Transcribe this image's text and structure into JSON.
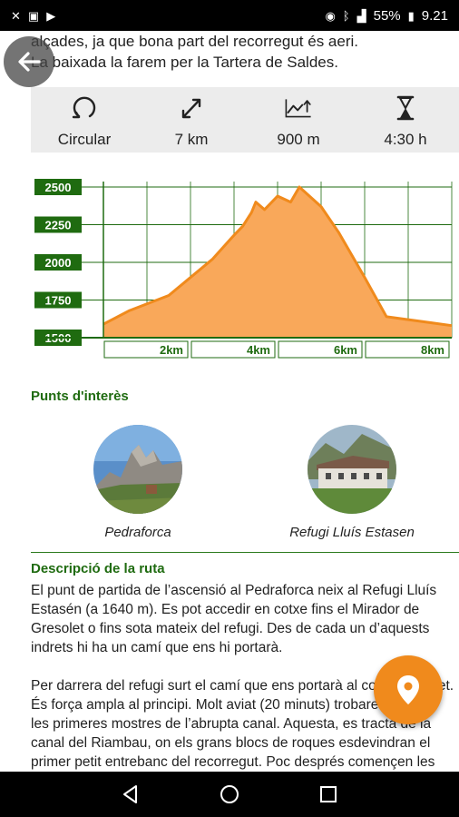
{
  "status_bar": {
    "battery": "55%",
    "time": "9.21"
  },
  "intro_lines": [
    "alçades, ja que bona part del recorregut és aeri.",
    "La baixada la farem per la Tartera de Saldes."
  ],
  "stats": [
    {
      "icon": "loop-icon",
      "label": "Circular"
    },
    {
      "icon": "distance-icon",
      "label": "7 km"
    },
    {
      "icon": "elevation-icon",
      "label": "900 m"
    },
    {
      "icon": "hourglass-icon",
      "label": "4:30 h"
    }
  ],
  "chart_data": {
    "type": "area",
    "x": [
      0,
      0.6,
      1.5,
      2.5,
      3.0,
      3.2,
      3.4,
      3.5,
      3.7,
      4.0,
      4.3,
      4.5,
      5.0,
      5.4,
      6.0,
      6.5,
      7.0,
      7.5,
      8.0
    ],
    "y": [
      1590,
      1680,
      1780,
      2020,
      2180,
      2240,
      2330,
      2400,
      2350,
      2440,
      2400,
      2500,
      2370,
      2200,
      1900,
      1640,
      1620,
      1600,
      1580
    ],
    "ytick_labels": [
      "1500",
      "1750",
      "2000",
      "2250",
      "2500"
    ],
    "xtick_labels": [
      "2km",
      "4km",
      "6km",
      "8km"
    ],
    "ylim": [
      1500,
      2500
    ],
    "xlim": [
      0,
      8
    ],
    "grid": true,
    "fill_color": "#f9a85a",
    "line_color": "#f08a1c",
    "axis_color": "#1f6b10"
  },
  "poi_section": {
    "title": "Punts d'interès",
    "items": [
      {
        "name": "Pedraforca"
      },
      {
        "name": "Refugi Lluís Estasen"
      }
    ]
  },
  "description": {
    "title": "Descripció de la ruta",
    "paragraphs": [
      "El punt de partida de l’ascensió al Pedraforca neix al Refugi Lluís Estasén (a 1640 m). Es pot accedir en cotxe fins el Mirador de Gresolet o fins sota mateix del refugi. Des de cada un d’aquests indrets hi ha un camí que ens hi portarà.",
      "Per darrera del refugi surt el camí que ens portarà al coll del Verdet. És força ampla al principi. Molt aviat (20 minuts) trobarem ja amb les primeres mostres de l’abrupta canal. Aquesta, es tracta de la canal del Riambau, on els grans blocs de roques esdevindran el primer petit entrebanc del recorregut. Poc després començen les fortes pendents, per un camí"
    ]
  },
  "colors": {
    "accent": "#1f6b10",
    "fab": "#f08a1c"
  }
}
